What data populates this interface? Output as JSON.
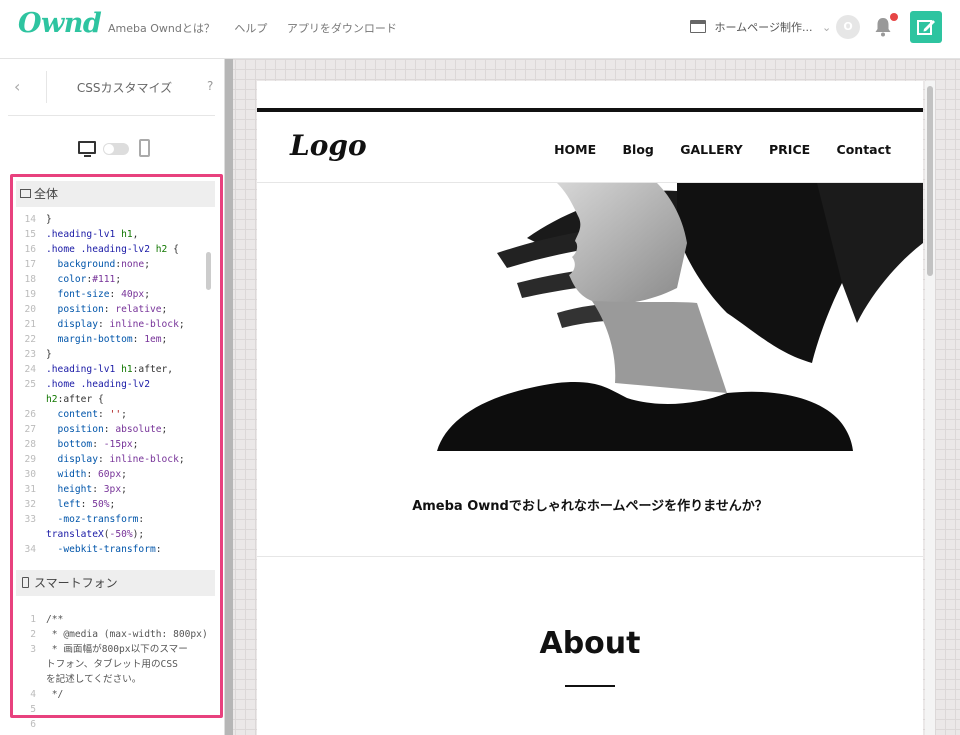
{
  "app": {
    "logo": "Ownd",
    "nav": [
      "Ameba Owndとは？",
      "ヘルプ",
      "アプリをダウンロード"
    ],
    "site_select": "ホームページ制作...",
    "avatar_letter": "O",
    "brand_color": "#2ec4a0",
    "notification_color": "#e64545"
  },
  "panel": {
    "title": "CSSカスタマイズ",
    "help": "?",
    "highlight_color": "#e8417e",
    "sections": {
      "desktop_label": "全体",
      "mobile_label": "スマートフォン"
    },
    "desktop_code": [
      {
        "n": "14",
        "t": [
          [
            "tok-pun",
            "}"
          ]
        ]
      },
      {
        "n": "15",
        "t": [
          [
            "tok-sel",
            ".heading-lv1 "
          ],
          [
            "tok-tag",
            "h1"
          ],
          [
            "tok-pun",
            ","
          ]
        ]
      },
      {
        "n": "16",
        "t": [
          [
            "tok-sel",
            ".home .heading-lv2 "
          ],
          [
            "tok-tag",
            "h2"
          ],
          [
            "tok-pun",
            " {"
          ]
        ]
      },
      {
        "n": "17",
        "t": [
          [
            "tok-prop",
            "  background"
          ],
          [
            "tok-pun",
            ":"
          ],
          [
            "tok-val",
            "none"
          ],
          [
            "tok-pun",
            ";"
          ]
        ]
      },
      {
        "n": "18",
        "t": [
          [
            "tok-prop",
            "  color"
          ],
          [
            "tok-pun",
            ":"
          ],
          [
            "tok-val",
            "#111"
          ],
          [
            "tok-pun",
            ";"
          ]
        ]
      },
      {
        "n": "19",
        "t": [
          [
            "tok-prop",
            "  font-size"
          ],
          [
            "tok-pun",
            ": "
          ],
          [
            "tok-val",
            "40px"
          ],
          [
            "tok-pun",
            ";"
          ]
        ]
      },
      {
        "n": "20",
        "t": [
          [
            "tok-prop",
            "  position"
          ],
          [
            "tok-pun",
            ": "
          ],
          [
            "tok-val",
            "relative"
          ],
          [
            "tok-pun",
            ";"
          ]
        ]
      },
      {
        "n": "21",
        "t": [
          [
            "tok-prop",
            "  display"
          ],
          [
            "tok-pun",
            ": "
          ],
          [
            "tok-val",
            "inline-block"
          ],
          [
            "tok-pun",
            ";"
          ]
        ]
      },
      {
        "n": "22",
        "t": [
          [
            "tok-prop",
            "  margin-bottom"
          ],
          [
            "tok-pun",
            ": "
          ],
          [
            "tok-val",
            "1em"
          ],
          [
            "tok-pun",
            ";"
          ]
        ]
      },
      {
        "n": "23",
        "t": [
          [
            "tok-pun",
            "}"
          ]
        ]
      },
      {
        "n": "24",
        "t": [
          [
            "tok-sel",
            ".heading-lv1 "
          ],
          [
            "tok-tag",
            "h1"
          ],
          [
            "tok-pun",
            ":after,"
          ]
        ]
      },
      {
        "n": "25",
        "t": [
          [
            "tok-sel",
            ".home .heading-lv2"
          ]
        ]
      },
      {
        "n": "",
        "t": [
          [
            "tok-tag",
            "h2"
          ],
          [
            "tok-pun",
            ":after {"
          ]
        ]
      },
      {
        "n": "26",
        "t": [
          [
            "tok-prop",
            "  content"
          ],
          [
            "tok-pun",
            ": "
          ],
          [
            "tok-str",
            "''"
          ],
          [
            "tok-pun",
            ";"
          ]
        ]
      },
      {
        "n": "27",
        "t": [
          [
            "tok-prop",
            "  position"
          ],
          [
            "tok-pun",
            ": "
          ],
          [
            "tok-val",
            "absolute"
          ],
          [
            "tok-pun",
            ";"
          ]
        ]
      },
      {
        "n": "28",
        "t": [
          [
            "tok-prop",
            "  bottom"
          ],
          [
            "tok-pun",
            ": "
          ],
          [
            "tok-val",
            "-15px"
          ],
          [
            "tok-pun",
            ";"
          ]
        ]
      },
      {
        "n": "29",
        "t": [
          [
            "tok-prop",
            "  display"
          ],
          [
            "tok-pun",
            ": "
          ],
          [
            "tok-val",
            "inline-block"
          ],
          [
            "tok-pun",
            ";"
          ]
        ]
      },
      {
        "n": "30",
        "t": [
          [
            "tok-prop",
            "  width"
          ],
          [
            "tok-pun",
            ": "
          ],
          [
            "tok-val",
            "60px"
          ],
          [
            "tok-pun",
            ";"
          ]
        ]
      },
      {
        "n": "31",
        "t": [
          [
            "tok-prop",
            "  height"
          ],
          [
            "tok-pun",
            ": "
          ],
          [
            "tok-val",
            "3px"
          ],
          [
            "tok-pun",
            ";"
          ]
        ]
      },
      {
        "n": "32",
        "t": [
          [
            "tok-prop",
            "  left"
          ],
          [
            "tok-pun",
            ": "
          ],
          [
            "tok-val",
            "50%"
          ],
          [
            "tok-pun",
            ";"
          ]
        ]
      },
      {
        "n": "33",
        "t": [
          [
            "tok-prop",
            "  -moz-transform"
          ],
          [
            "tok-pun",
            ":"
          ]
        ]
      },
      {
        "n": "",
        "t": [
          [
            "tok-sel",
            "translateX"
          ],
          [
            "tok-pun",
            "("
          ],
          [
            "tok-val",
            "-50%"
          ],
          [
            "tok-pun",
            ");"
          ]
        ]
      },
      {
        "n": "34",
        "t": [
          [
            "tok-prop",
            "  -webkit-transform"
          ],
          [
            "tok-pun",
            ":"
          ]
        ]
      }
    ],
    "mobile_code": [
      {
        "n": "1",
        "t": [
          [
            "tok-com",
            "/**"
          ]
        ]
      },
      {
        "n": "2",
        "t": [
          [
            "tok-com",
            " * @media (max-width: 800px)"
          ]
        ]
      },
      {
        "n": "3",
        "t": [
          [
            "tok-com",
            " * 画面幅が800px以下のスマー"
          ]
        ]
      },
      {
        "n": "",
        "t": [
          [
            "tok-com",
            "トフォン、タブレット用のCSS"
          ]
        ]
      },
      {
        "n": "",
        "t": [
          [
            "tok-com",
            "を記述してください。"
          ]
        ]
      },
      {
        "n": "4",
        "t": [
          [
            "tok-com",
            " */"
          ]
        ]
      },
      {
        "n": "5",
        "t": []
      },
      {
        "n": "6",
        "t": []
      }
    ]
  },
  "site": {
    "logo": "Logo",
    "nav": [
      "HOME",
      "Blog",
      "GALLERY",
      "PRICE",
      "Contact"
    ],
    "tagline": "Ameba Owndでおしゃれなホームページを作りませんか？",
    "about_heading": "About"
  }
}
